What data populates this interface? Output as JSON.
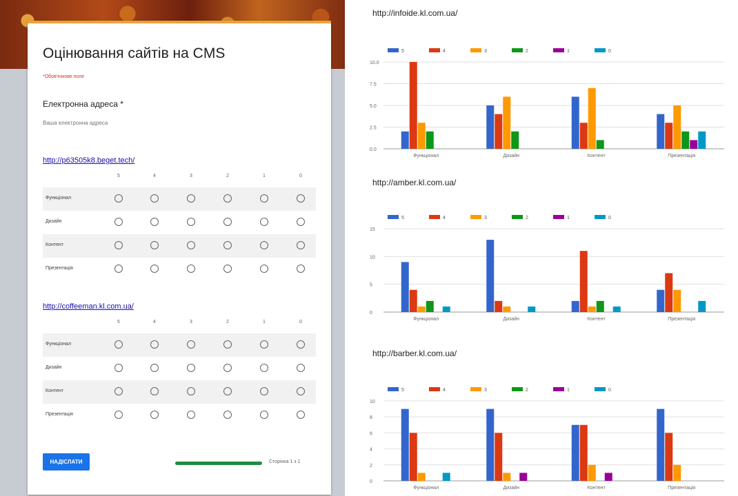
{
  "form": {
    "title": "Оцінювання сайтів на CMS",
    "required_note": "*Обов'язкове поле",
    "email_label": "Електронна адреса *",
    "email_placeholder": "Ваша електронна адреса",
    "columns": [
      "5",
      "4",
      "3",
      "2",
      "1",
      "0"
    ],
    "rows": [
      "Функціонал",
      "Дизайн",
      "Контент",
      "Презентація"
    ],
    "sections": [
      {
        "link": "http://p63505k8.beget.tech/"
      },
      {
        "link": "http://coffeeman.kl.com.ua/"
      }
    ],
    "submit_label": "НАДІСЛАТИ",
    "progress": 1.0,
    "page_indicator": "Сторінка 1 з 1"
  },
  "colors": {
    "5": "#3366cc",
    "4": "#dc3912",
    "3": "#ff9900",
    "2": "#109618",
    "1": "#990099",
    "0": "#0099c6"
  },
  "chart_data": [
    {
      "type": "bar",
      "title": "http://infoide.kl.com.ua/",
      "categories": [
        "Функціонал",
        "Дизайн",
        "Контент",
        "Презентація"
      ],
      "yticks": [
        "0.0",
        "2.5",
        "5.0",
        "7.5",
        "10.0"
      ],
      "ylim": [
        0,
        10
      ],
      "legend": "top-left",
      "grid": true,
      "series": [
        {
          "name": "5",
          "values": [
            2,
            5,
            6,
            4
          ]
        },
        {
          "name": "4",
          "values": [
            10,
            4,
            3,
            3
          ]
        },
        {
          "name": "3",
          "values": [
            3,
            6,
            7,
            5
          ]
        },
        {
          "name": "2",
          "values": [
            2,
            2,
            1,
            2
          ]
        },
        {
          "name": "1",
          "values": [
            0,
            0,
            0,
            1
          ]
        },
        {
          "name": "0",
          "values": [
            0,
            0,
            0,
            2
          ]
        }
      ]
    },
    {
      "type": "bar",
      "title": "http://amber.kl.com.ua/",
      "categories": [
        "Функціонал",
        "Дизайн",
        "Контент",
        "Презентація"
      ],
      "yticks": [
        "0",
        "5",
        "10",
        "15"
      ],
      "ylim": [
        0,
        15
      ],
      "legend": "top-left",
      "grid": true,
      "series": [
        {
          "name": "5",
          "values": [
            9,
            13,
            2,
            4
          ]
        },
        {
          "name": "4",
          "values": [
            4,
            2,
            11,
            7
          ]
        },
        {
          "name": "3",
          "values": [
            1,
            1,
            1,
            4
          ]
        },
        {
          "name": "2",
          "values": [
            2,
            0,
            2,
            0
          ]
        },
        {
          "name": "1",
          "values": [
            0,
            0,
            0,
            0
          ]
        },
        {
          "name": "0",
          "values": [
            1,
            1,
            1,
            2
          ]
        }
      ]
    },
    {
      "type": "bar",
      "title": "http://barber.kl.com.ua/",
      "categories": [
        "Функціонал",
        "Дизайн",
        "Контент",
        "Презентація"
      ],
      "yticks": [
        "0",
        "2",
        "4",
        "6",
        "8",
        "10"
      ],
      "ylim": [
        0,
        10
      ],
      "legend": "top-left",
      "grid": true,
      "series": [
        {
          "name": "5",
          "values": [
            9,
            9,
            7,
            9
          ]
        },
        {
          "name": "4",
          "values": [
            6,
            6,
            7,
            6
          ]
        },
        {
          "name": "3",
          "values": [
            1,
            1,
            2,
            2
          ]
        },
        {
          "name": "2",
          "values": [
            0,
            0,
            0,
            0
          ]
        },
        {
          "name": "1",
          "values": [
            0,
            1,
            1,
            0
          ]
        },
        {
          "name": "0",
          "values": [
            1,
            0,
            0,
            0
          ]
        }
      ]
    }
  ]
}
